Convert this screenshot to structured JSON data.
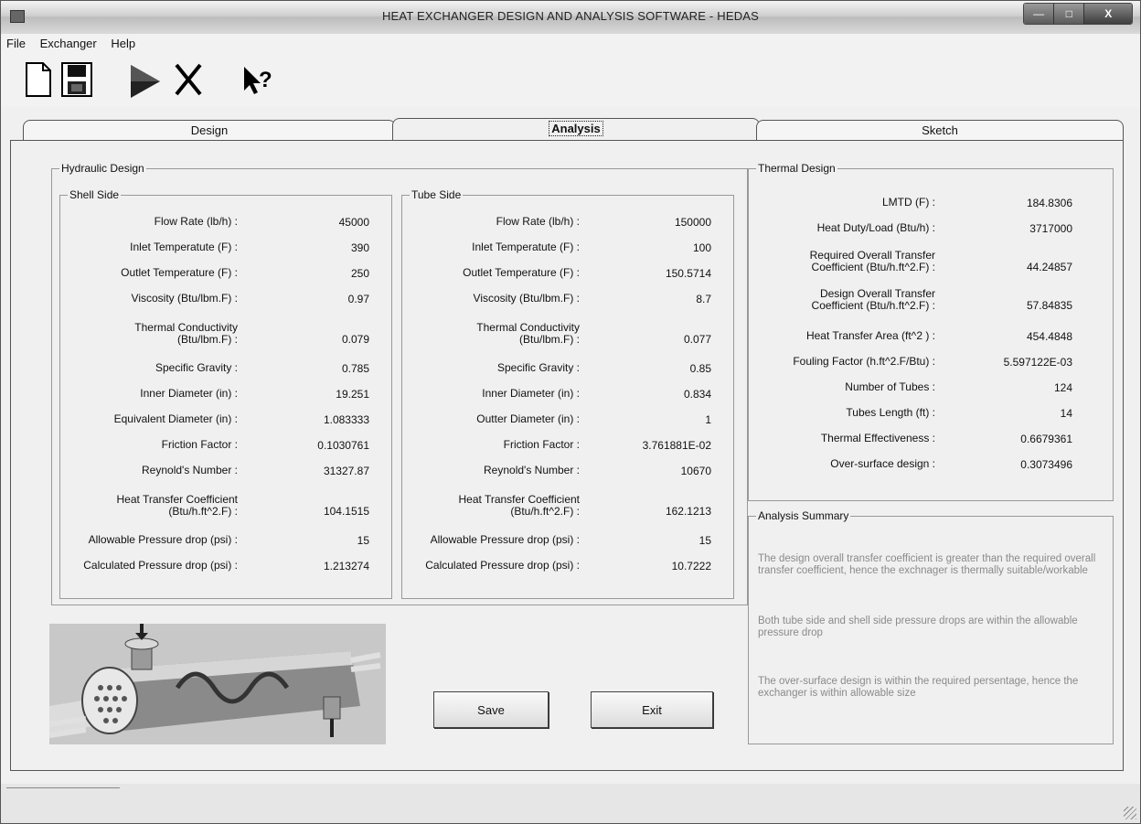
{
  "window": {
    "title": "HEAT EXCHANGER DESIGN AND ANALYSIS SOFTWARE - HEDAS"
  },
  "menu": [
    "File",
    "Exchanger",
    "Help"
  ],
  "toolbar_icons": [
    "new-file-icon",
    "save-disk-icon",
    "run-arrow-icon",
    "cancel-x-icon",
    "help-pointer-icon"
  ],
  "tabs": [
    {
      "label": "Design",
      "active": false
    },
    {
      "label": "Analysis",
      "active": true
    },
    {
      "label": "Sketch",
      "active": false
    }
  ],
  "hydraulic": {
    "title": "Hydraulic Design",
    "shell": {
      "title": "Shell Side",
      "rows": [
        {
          "label": "Flow Rate (lb/h) :",
          "value": "45000"
        },
        {
          "label": "Inlet Temperatute (F) :",
          "value": "390"
        },
        {
          "label": "Outlet Temperature (F) :",
          "value": "250"
        },
        {
          "label": "Viscosity (Btu/lbm.F) :",
          "value": "0.97"
        },
        {
          "label": "Thermal Conductivity\n(Btu/lbm.F) :",
          "value": "0.079"
        },
        {
          "label": "Specific Gravity :",
          "value": "0.785"
        },
        {
          "label": "Inner Diameter (in) :",
          "value": "19.251"
        },
        {
          "label": "Equivalent Diameter (in) :",
          "value": "1.083333"
        },
        {
          "label": "Friction Factor :",
          "value": "0.1030761"
        },
        {
          "label": "Reynold's Number :",
          "value": "31327.87"
        },
        {
          "label": "Heat Transfer Coefficient\n(Btu/h.ft^2.F) :",
          "value": "104.1515"
        },
        {
          "label": "Allowable Pressure drop (psi) :",
          "value": "15"
        },
        {
          "label": "Calculated Pressure drop (psi) :",
          "value": "1.213274"
        }
      ]
    },
    "tube": {
      "title": "Tube Side",
      "rows": [
        {
          "label": "Flow Rate (lb/h) :",
          "value": "150000"
        },
        {
          "label": "Inlet Temperatute (F) :",
          "value": "100"
        },
        {
          "label": "Outlet Temperature (F) :",
          "value": "150.5714"
        },
        {
          "label": "Viscosity (Btu/lbm.F) :",
          "value": "8.7"
        },
        {
          "label": "Thermal Conductivity\n(Btu/lbm.F) :",
          "value": "0.077"
        },
        {
          "label": "Specific Gravity :",
          "value": "0.85"
        },
        {
          "label": "Inner Diameter (in) :",
          "value": "0.834"
        },
        {
          "label": "Outter Diameter (in) :",
          "value": "1"
        },
        {
          "label": "Friction Factor :",
          "value": "3.761881E-02"
        },
        {
          "label": "Reynold's Number :",
          "value": "10670"
        },
        {
          "label": "Heat Transfer Coefficient\n(Btu/h.ft^2.F) :",
          "value": "162.1213"
        },
        {
          "label": "Allowable Pressure drop (psi) :",
          "value": "15"
        },
        {
          "label": "Calculated Pressure drop (psi) :",
          "value": "10.7222"
        }
      ]
    }
  },
  "thermal": {
    "title": "Thermal Design",
    "rows": [
      {
        "label": "LMTD (F) :",
        "value": "184.8306"
      },
      {
        "label": "Heat Duty/Load (Btu/h) :",
        "value": "3717000"
      },
      {
        "label": "Required Overall Transfer\nCoefficient (Btu/h.ft^2.F) :",
        "value": "44.24857"
      },
      {
        "label": "Design Overall Transfer\nCoefficient (Btu/h.ft^2.F) :",
        "value": "57.84835"
      },
      {
        "label": "Heat Transfer Area (ft^2 ) :",
        "value": "454.4848"
      },
      {
        "label": "Fouling Factor (h.ft^2.F/Btu) :",
        "value": "5.597122E-03"
      },
      {
        "label": "Number of Tubes :",
        "value": "124"
      },
      {
        "label": "Tubes Length (ft) :",
        "value": "14"
      },
      {
        "label": "Thermal Effectiveness :",
        "value": "0.6679361"
      },
      {
        "label": "Over-surface design :",
        "value": "0.3073496"
      }
    ]
  },
  "summary": {
    "title": "Analysis Summary",
    "lines": [
      "The design overall transfer coefficient is greater than the required overall transfer coefficient, hence the exchnager is thermally suitable/workable",
      "Both tube side and shell side pressure drops are within the allowable pressure drop",
      "The over-surface design is within the required persentage, hence the exchanger is within allowable size"
    ]
  },
  "buttons": {
    "save": "Save",
    "exit": "Exit"
  }
}
